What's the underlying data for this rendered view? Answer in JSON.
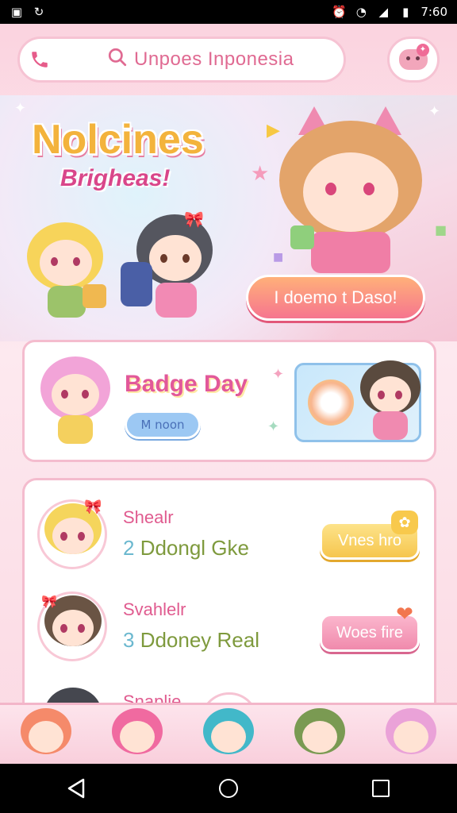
{
  "status_bar": {
    "time": "7:60"
  },
  "search": {
    "text": "Unpoes Inponesia"
  },
  "hero": {
    "title": "Nolcines",
    "subtitle": "Brigheas!",
    "cta_label": "I doemo t Daso!"
  },
  "badge_card": {
    "title": "Badge Day",
    "button_label": "M noon"
  },
  "list": {
    "items": [
      {
        "name": "Shealr",
        "desc_num": "2",
        "desc_text": " Ddongl Gke",
        "button_label": "Vnes hro",
        "button_style": "yellow",
        "icon": "paw-icon"
      },
      {
        "name": "Svahlelr",
        "desc_num": "3",
        "desc_text": " Ddoney Real",
        "button_label": "Woes fire",
        "button_style": "pink",
        "icon": "heart-icon"
      },
      {
        "name": "Snaplie",
        "desc_num": "",
        "desc_text": "",
        "button_label": "",
        "button_style": "",
        "icon": ""
      }
    ]
  },
  "colors": {
    "accent_pink": "#e65c8a",
    "yellow_button": "#f6c64e",
    "pink_button": "#f08aac",
    "cta_gradient_top": "#ffb079",
    "cta_gradient_bottom": "#f6758f"
  }
}
